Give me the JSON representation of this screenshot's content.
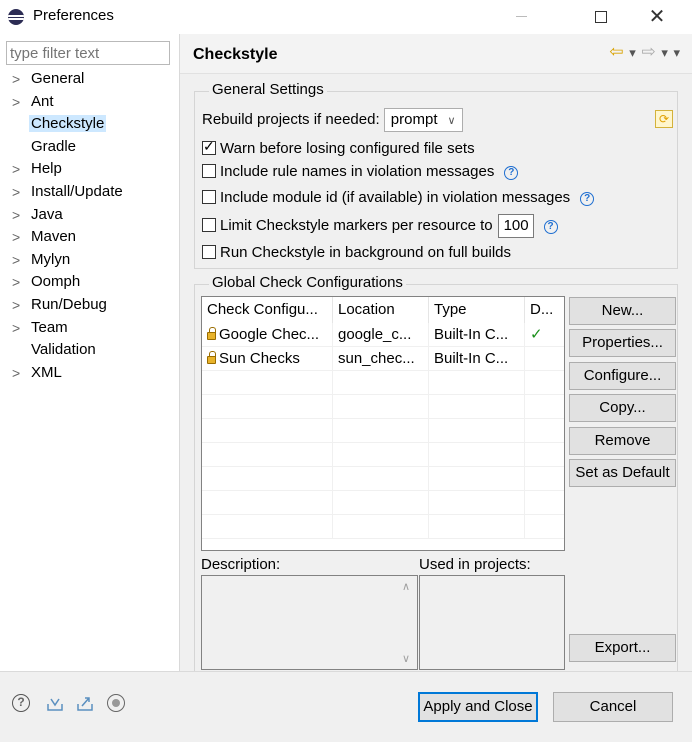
{
  "window": {
    "title": "Preferences"
  },
  "filter": {
    "placeholder": "type filter text"
  },
  "tree": [
    {
      "label": "General",
      "expandable": true
    },
    {
      "label": "Ant",
      "expandable": true
    },
    {
      "label": "Checkstyle",
      "expandable": false,
      "selected": true
    },
    {
      "label": "Gradle",
      "expandable": false
    },
    {
      "label": "Help",
      "expandable": true
    },
    {
      "label": "Install/Update",
      "expandable": true
    },
    {
      "label": "Java",
      "expandable": true
    },
    {
      "label": "Maven",
      "expandable": true
    },
    {
      "label": "Mylyn",
      "expandable": true
    },
    {
      "label": "Oomph",
      "expandable": true
    },
    {
      "label": "Run/Debug",
      "expandable": true
    },
    {
      "label": "Team",
      "expandable": true
    },
    {
      "label": "Validation",
      "expandable": false
    },
    {
      "label": "XML",
      "expandable": true
    }
  ],
  "page": {
    "title": "Checkstyle"
  },
  "general": {
    "legend": "General Settings",
    "rebuild_label": "Rebuild projects if needed:",
    "rebuild_value": "prompt",
    "warn_label": "Warn before losing configured file sets",
    "include_rule_label": "Include rule names in violation messages",
    "include_module_label": "Include module id (if available) in violation messages",
    "limit_label": "Limit Checkstyle markers per resource to",
    "limit_value": "100",
    "background_label": "Run Checkstyle in background on full builds"
  },
  "global": {
    "legend": "Global Check Configurations",
    "columns": [
      "Check Configu...",
      "Location",
      "Type",
      "D..."
    ],
    "rows": [
      {
        "name": "Google Chec...",
        "location": "google_c...",
        "type": "Built-In C...",
        "default": "✓"
      },
      {
        "name": "Sun Checks",
        "location": "sun_chec...",
        "type": "Built-In C...",
        "default": ""
      }
    ],
    "buttons": {
      "new": "New...",
      "properties": "Properties...",
      "configure": "Configure...",
      "copy": "Copy...",
      "remove": "Remove",
      "set_default": "Set as Default",
      "export": "Export..."
    },
    "description_label": "Description:",
    "used_label": "Used in projects:"
  },
  "footer": {
    "apply_close": "Apply and Close",
    "cancel": "Cancel"
  }
}
